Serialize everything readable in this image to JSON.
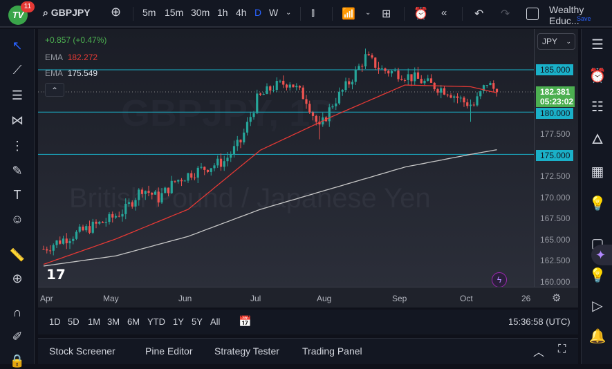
{
  "topbar": {
    "notifications": "11",
    "logo": "TV",
    "symbol": "GBPJPY",
    "intervals": [
      "5m",
      "15m",
      "30m",
      "1h",
      "4h",
      "D",
      "W"
    ],
    "active_interval": "D",
    "layout_name": "Wealthy Educ...",
    "save_label": "Save"
  },
  "legend": {
    "change": "+0.857 (+0.47%)",
    "ema1_label": "EMA",
    "ema1_value": "182.272",
    "ema2_label": "EMA",
    "ema2_value": "175.549"
  },
  "watermark": {
    "symbol": "GBPJPY, 1D",
    "description": "British Pound / Japanese Yen"
  },
  "axis": {
    "currency": "JPY",
    "current_price": "182.381",
    "countdown": "05:23:02",
    "hline_labels": [
      "185.000",
      "180.000",
      "175.000"
    ],
    "ticks": [
      "177.500",
      "172.500",
      "170.000",
      "167.500",
      "165.000",
      "162.500",
      "160.000"
    ]
  },
  "time_labels": [
    "Apr",
    "May",
    "Jun",
    "Jul",
    "Aug",
    "Sep",
    "Oct",
    "26"
  ],
  "bottombar": {
    "ranges": [
      "1D",
      "5D",
      "1M",
      "3M",
      "6M",
      "YTD",
      "1Y",
      "5Y",
      "All"
    ],
    "clock": "15:36:58 (UTC)"
  },
  "panel": {
    "tabs": [
      "Stock Screener",
      "Pine Editor",
      "Strategy Tester",
      "Trading Panel"
    ]
  },
  "colors": {
    "up": "#26a69a",
    "down": "#ef5350",
    "ema_fast": "#e53935",
    "ema_slow": "#c8c8c8",
    "hline": "#1ab0c8",
    "current": "#4caf50"
  },
  "chart_data": {
    "type": "candlestick",
    "symbol": "GBPJPY",
    "timeframe": "1D",
    "ylim": [
      159.5,
      188
    ],
    "hlines": [
      185,
      180,
      175
    ],
    "weekly_close": [
      [
        0,
        163.8
      ],
      [
        5,
        164.8
      ],
      [
        10,
        165.6
      ],
      [
        15,
        166.5
      ],
      [
        20,
        167.3
      ],
      [
        25,
        168.5
      ],
      [
        30,
        171
      ],
      [
        35,
        169.8
      ],
      [
        40,
        171.8
      ],
      [
        45,
        172.8
      ],
      [
        50,
        173.5
      ],
      [
        55,
        174.2
      ],
      [
        60,
        176.5
      ],
      [
        65,
        181.5
      ],
      [
        70,
        183
      ],
      [
        75,
        183.6
      ],
      [
        80,
        181.5
      ],
      [
        84,
        178
      ],
      [
        88,
        181
      ],
      [
        93,
        183.5
      ],
      [
        98,
        186.5
      ],
      [
        103,
        185
      ],
      [
        108,
        184.6
      ],
      [
        113,
        184
      ],
      [
        118,
        183.2
      ],
      [
        123,
        182.5
      ],
      [
        128,
        181.2
      ],
      [
        131,
        180.8
      ],
      [
        135,
        183.5
      ],
      [
        138,
        182.38
      ]
    ],
    "ema_fast": [
      [
        0,
        162
      ],
      [
        22,
        165
      ],
      [
        44,
        168.5
      ],
      [
        66,
        175.5
      ],
      [
        88,
        179.5
      ],
      [
        110,
        183.2
      ],
      [
        130,
        183
      ],
      [
        138,
        182.27
      ]
    ],
    "ema_slow": [
      [
        0,
        161.8
      ],
      [
        22,
        163
      ],
      [
        44,
        165.3
      ],
      [
        66,
        168.5
      ],
      [
        88,
        171
      ],
      [
        110,
        173.5
      ],
      [
        130,
        175
      ],
      [
        138,
        175.55
      ]
    ]
  }
}
